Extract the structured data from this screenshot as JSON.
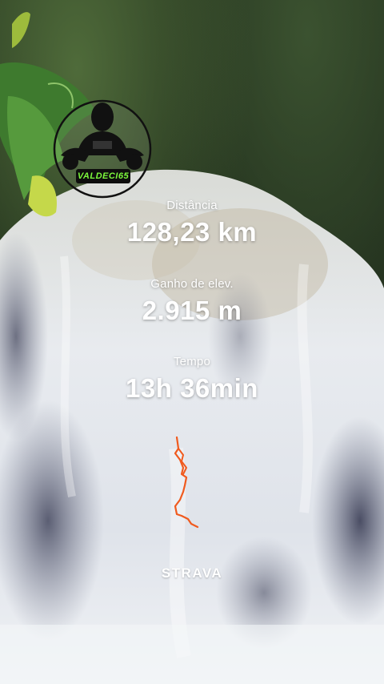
{
  "stats": [
    {
      "label": "Distância",
      "value": "128,23 km"
    },
    {
      "label": "Ganho de elev.",
      "value": "2.915 m"
    },
    {
      "label": "Tempo",
      "value": "13h 36min"
    }
  ],
  "badge": {
    "text": "VALDECI65"
  },
  "brand": {
    "name": "STRAVA"
  },
  "colors": {
    "route": "#f05a1e",
    "badge_text": "#7cf83c",
    "text": "#ffffff"
  },
  "icons": {
    "logo": "helmet-rider-logo-icon"
  }
}
